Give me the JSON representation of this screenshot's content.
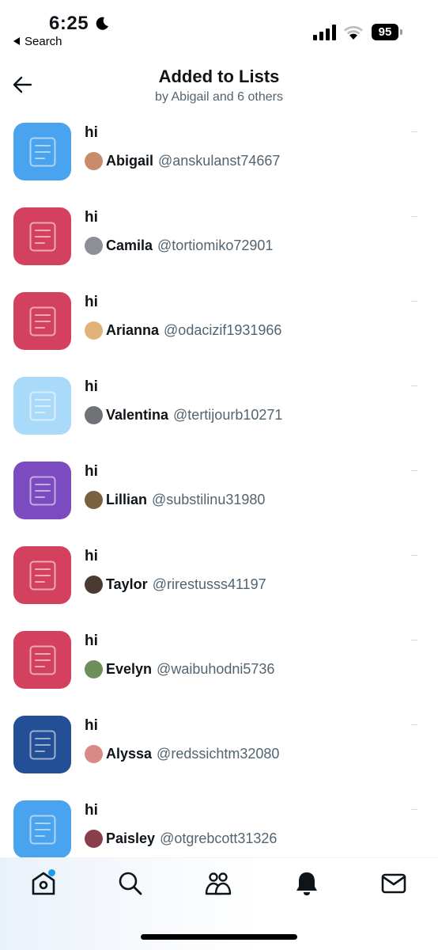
{
  "status_bar": {
    "time": "6:25",
    "back_app": "Search",
    "battery": "95"
  },
  "header": {
    "title": "Added to Lists",
    "subtitle": "by Abigail and 6 others"
  },
  "lists": [
    {
      "name": "hi",
      "owner_name": "Abigail",
      "owner_handle": "@anskulanst74667",
      "color": "#4aa3ee",
      "avatar_color": "#c98c6b"
    },
    {
      "name": "hi",
      "owner_name": "Camila",
      "owner_handle": "@tortiomiko72901",
      "color": "#d4415f",
      "avatar_color": "#8c8f95"
    },
    {
      "name": "hi",
      "owner_name": "Arianna",
      "owner_handle": "@odacizif1931966",
      "color": "#d4415f",
      "avatar_color": "#e0b27a"
    },
    {
      "name": "hi",
      "owner_name": "Valentina",
      "owner_handle": "@tertijourb10271",
      "color": "#aadaf9",
      "avatar_color": "#6f7378"
    },
    {
      "name": "hi",
      "owner_name": "Lillian",
      "owner_handle": "@substilinu31980",
      "color": "#7b4bbf",
      "avatar_color": "#7a6040"
    },
    {
      "name": "hi",
      "owner_name": "Taylor",
      "owner_handle": "@rirestusss41197",
      "color": "#d4415f",
      "avatar_color": "#4b3a32"
    },
    {
      "name": "hi",
      "owner_name": "Evelyn",
      "owner_handle": "@waibuhodni5736",
      "color": "#d4415f",
      "avatar_color": "#6e8f5a"
    },
    {
      "name": "hi",
      "owner_name": "Alyssa",
      "owner_handle": "@redssichtm32080",
      "color": "#234f96",
      "avatar_color": "#d98a86"
    },
    {
      "name": "hi",
      "owner_name": "Paisley",
      "owner_handle": "@otgrebcott31326",
      "color": "#4aa3ee",
      "avatar_color": "#8a3e4a"
    }
  ],
  "tab_bar": {
    "tabs": [
      "home",
      "explore",
      "communities",
      "notifications",
      "messages"
    ],
    "accent": "#1d9bf0"
  }
}
